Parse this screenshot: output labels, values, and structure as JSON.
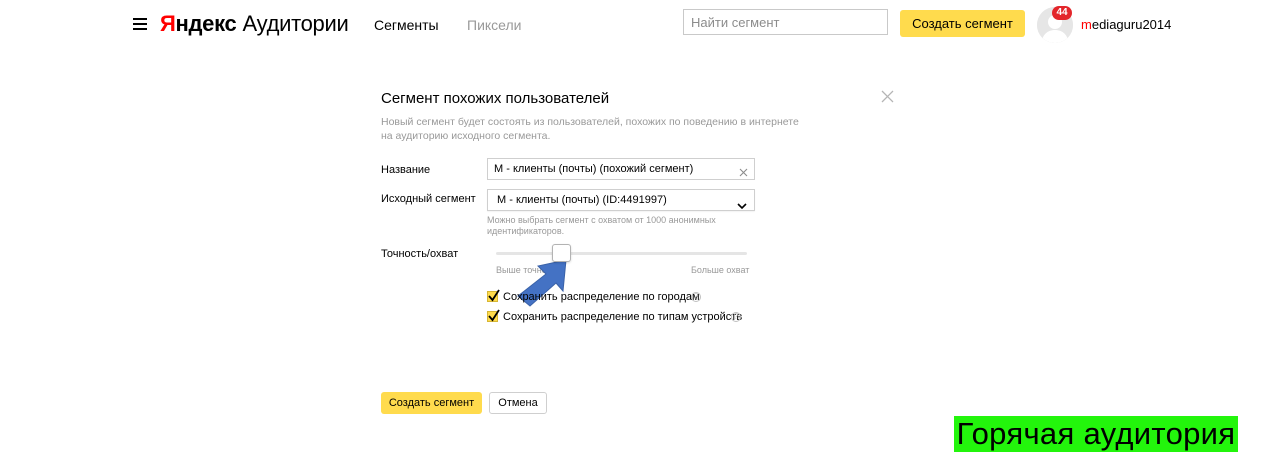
{
  "header": {
    "logo_brand_first": "Я",
    "logo_brand_rest": "ндекс",
    "logo_product": "Аудитории",
    "nav": {
      "segments": "Сегменты",
      "pixels": "Пиксели"
    },
    "search_placeholder": "Найти сегмент",
    "create_button": "Создать сегмент",
    "notifications_count": "44",
    "username_first": "m",
    "username_rest": "ediaguru2014"
  },
  "dialog": {
    "title": "Сегмент похожих пользователей",
    "description": "Новый сегмент будет состоять из пользователей, похожих по поведению в интернете на аудиторию исходного сегмента.",
    "name_label": "Название",
    "name_value": "М - клиенты (почты) (похожий сегмент)",
    "source_label": "Исходный сегмент",
    "source_value": "М - клиенты (почты) (ID:4491997)",
    "source_hint": "Можно выбрать сегмент с охватом от 1000 анонимных идентификаторов.",
    "accuracy_label": "Точность/охват",
    "slider_left_label": "Выше точность",
    "slider_right_label": "Больше охват",
    "slider_level_fraction": 0.26,
    "checkbox_cities_label": "Сохранить распределение по городам",
    "checkbox_cities_checked": true,
    "checkbox_devices_label": "Сохранить распределение по типам устройств",
    "checkbox_devices_checked": true,
    "help_symbol": "?",
    "create_button": "Создать сегмент",
    "cancel_button": "Отмена"
  },
  "overlay_label": "Горячая аудитория",
  "colors": {
    "accent_yellow": "#ffdb4d",
    "brand_red": "#ff0000",
    "badge_red": "#e3262b",
    "arrow_blue": "#4472c4",
    "overlay_green": "#23f50c"
  },
  "icons": {
    "menu": "hamburger-icon",
    "close": "close-icon",
    "clear": "clear-icon",
    "dropdown": "chevron-down-icon",
    "checkmark": "checkmark-icon",
    "help": "help-icon",
    "pointer": "arrow-icon"
  }
}
